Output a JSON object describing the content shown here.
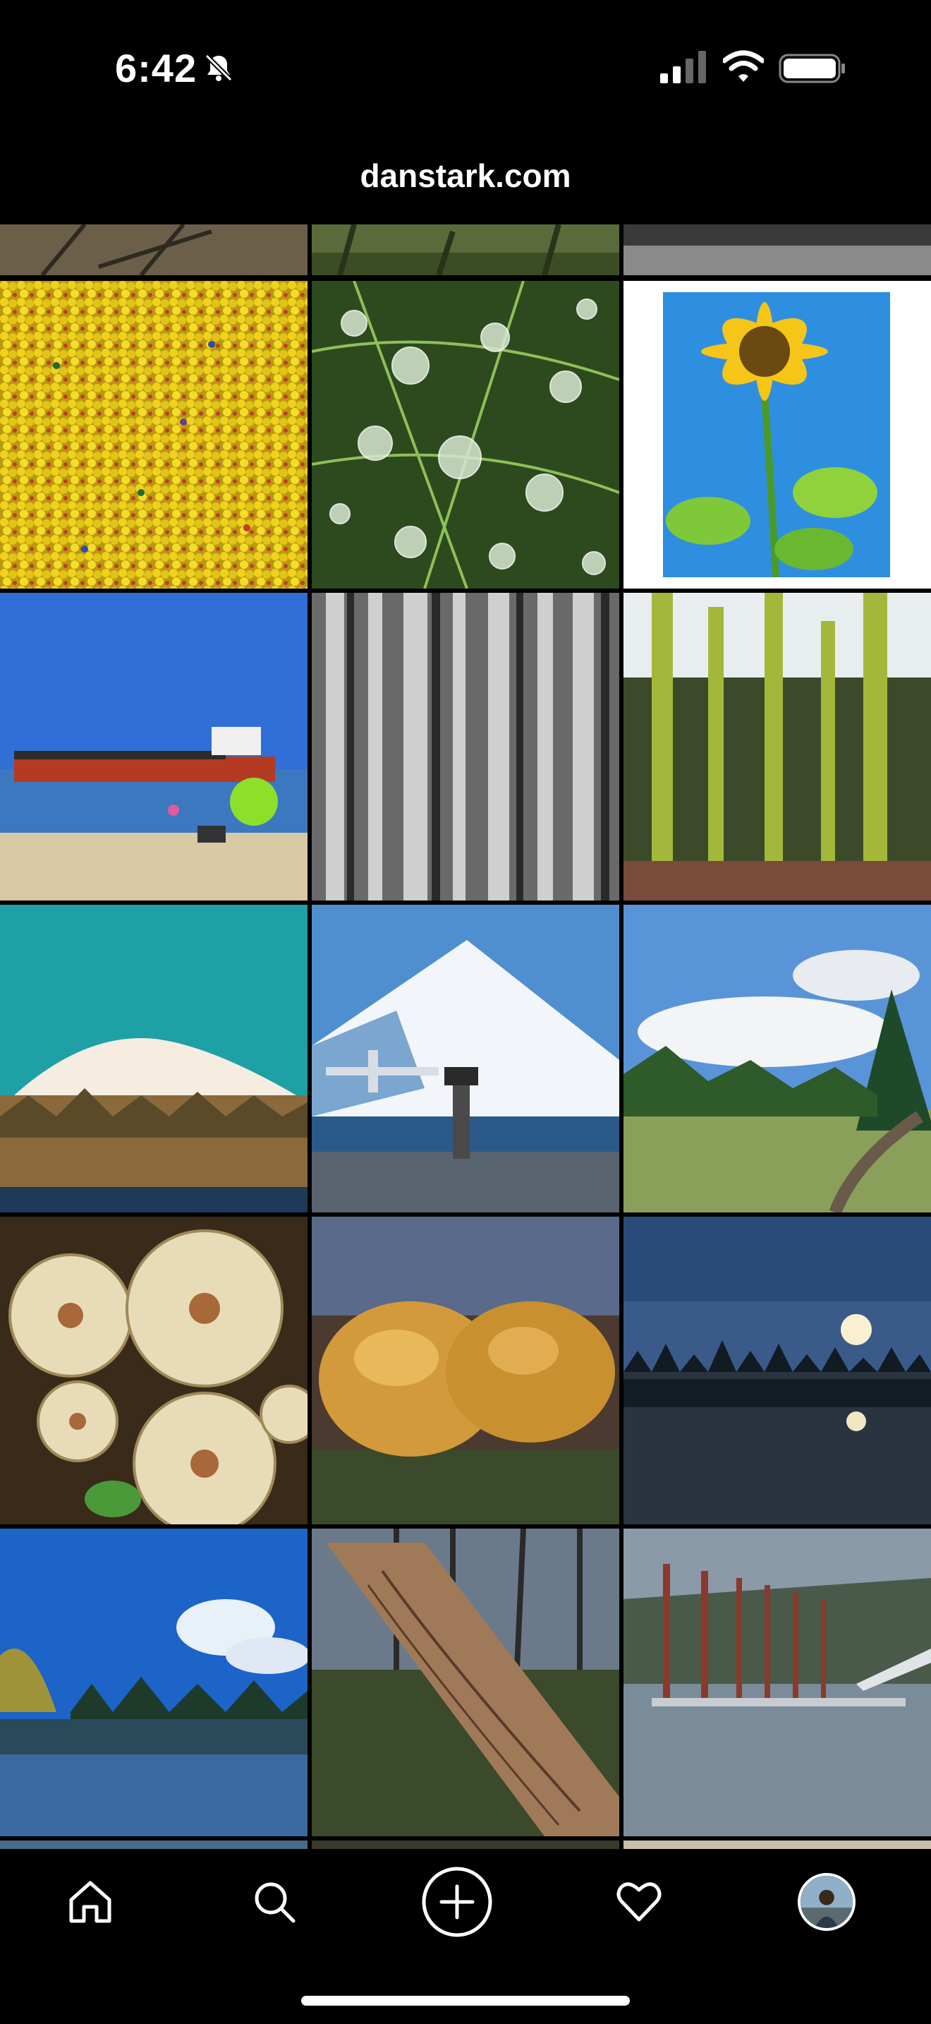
{
  "status_bar": {
    "time": "6:42",
    "icons": [
      "bell-slash-icon",
      "cellular-signal-icon",
      "wifi-icon",
      "battery-icon"
    ]
  },
  "header": {
    "title": "danstark.com"
  },
  "grid": {
    "photos": [
      {
        "subject": "yellow beads"
      },
      {
        "subject": "dew drops on web"
      },
      {
        "subject": "sunflower"
      },
      {
        "subject": "ship on river beach"
      },
      {
        "subject": "black and white forest"
      },
      {
        "subject": "mossy forest"
      },
      {
        "subject": "snowy mountain teal sky"
      },
      {
        "subject": "mountain, airplane and control tower"
      },
      {
        "subject": "park with trees and clouds"
      },
      {
        "subject": "mushroom cluster"
      },
      {
        "subject": "two orange mushrooms"
      },
      {
        "subject": "lake with sun reflection"
      },
      {
        "subject": "lake with blue sky reflection"
      },
      {
        "subject": "fallen tree trunk"
      },
      {
        "subject": "marina pilings reflection"
      }
    ]
  },
  "tabbar": {
    "items": [
      {
        "icon": "home-icon"
      },
      {
        "icon": "search-icon"
      },
      {
        "icon": "add-post-icon"
      },
      {
        "icon": "heart-icon"
      },
      {
        "icon": "profile-avatar"
      }
    ]
  },
  "colors": {
    "background": "#000000",
    "text": "#ffffff"
  }
}
